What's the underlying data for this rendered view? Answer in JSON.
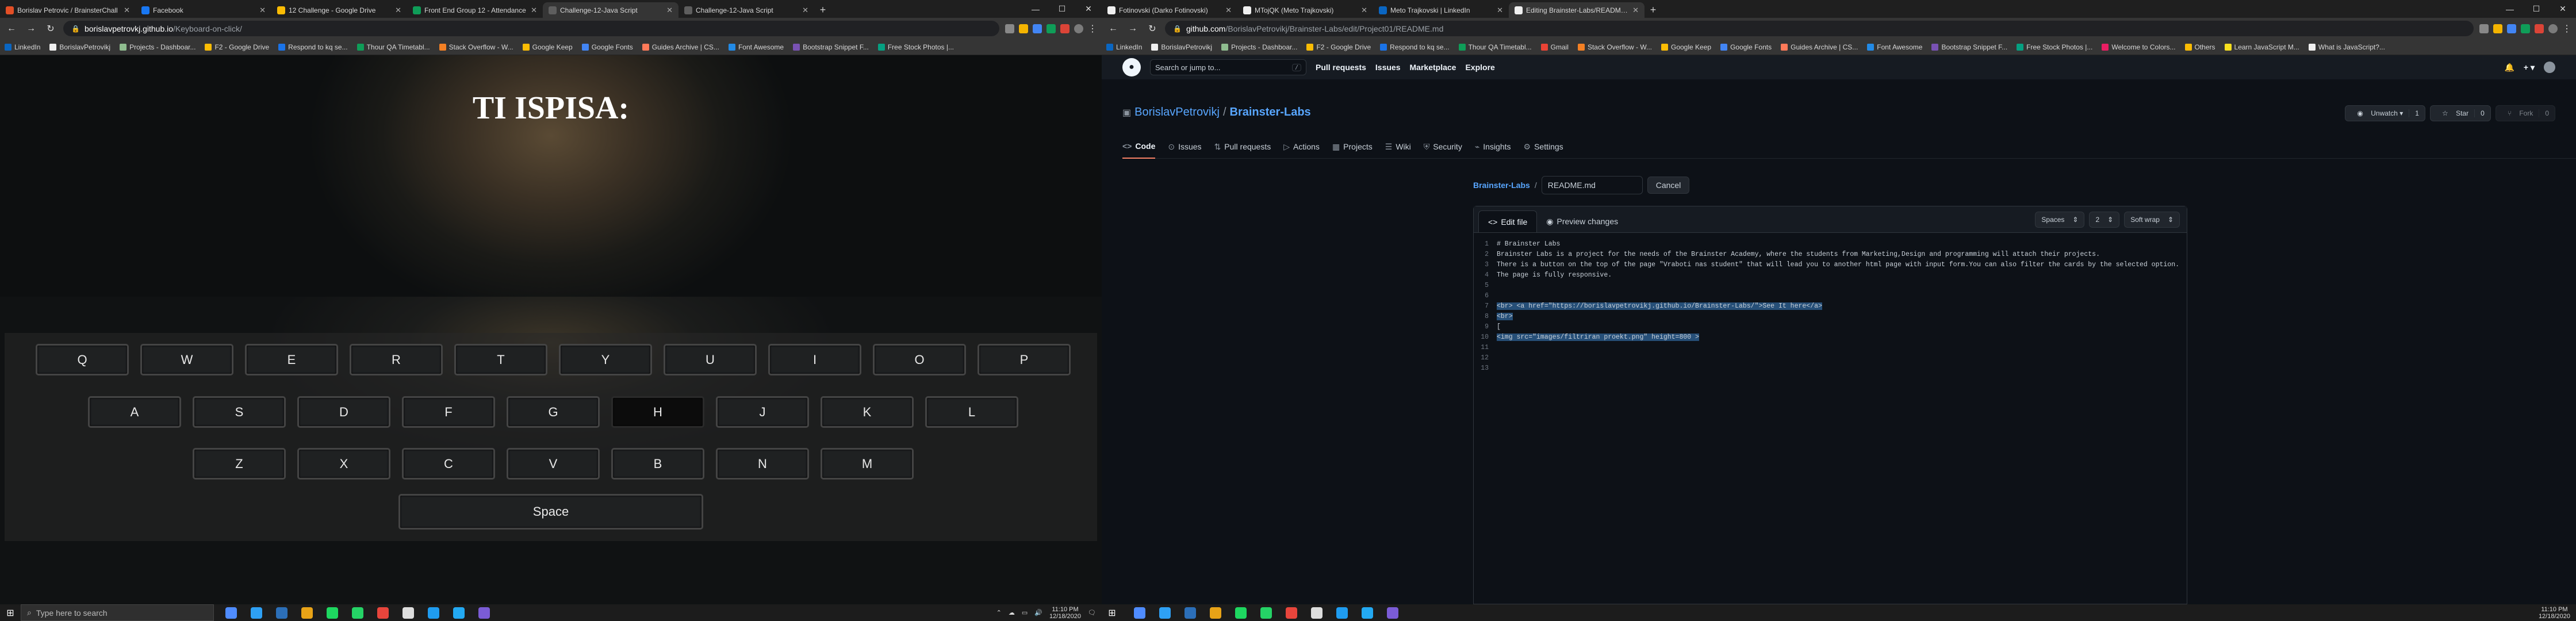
{
  "left_browser": {
    "tabs": [
      {
        "title": "Borislav Petrovic / BrainsterChall",
        "fav": "#e34f26",
        "active": false
      },
      {
        "title": "Facebook",
        "fav": "#1877f2",
        "active": false
      },
      {
        "title": "12 Challenge - Google Drive",
        "fav": "#fbbc04",
        "active": false
      },
      {
        "title": "Front End Group 12 - Attendance",
        "fav": "#0f9d58",
        "active": false
      },
      {
        "title": "Challenge-12-Java Script",
        "fav": "#5e5e5e",
        "active": true
      },
      {
        "title": "Challenge-12-Java Script",
        "fav": "#5e5e5e",
        "active": false
      }
    ],
    "address": {
      "host": "borislavpetrovkj.github.io",
      "path": "/Keyboard-on-click/"
    },
    "bookmarks": [
      {
        "label": "LinkedIn",
        "color": "#0a66c2"
      },
      {
        "label": "BorislavPetrovikj",
        "color": "#f0f0f0"
      },
      {
        "label": "Projects - Dashboar...",
        "color": "#8fbc8f"
      },
      {
        "label": "F2 - Google Drive",
        "color": "#fbbc04"
      },
      {
        "label": "Respond to kq se...",
        "color": "#1a73e8"
      },
      {
        "label": "Thour QA Timetabl...",
        "color": "#0f9d58"
      },
      {
        "label": "Stack Overflow - W...",
        "color": "#f48024"
      },
      {
        "label": "Google Keep",
        "color": "#fbbc04"
      },
      {
        "label": "Google Fonts",
        "color": "#4285f4"
      },
      {
        "label": "Guides Archive | CS...",
        "color": "#ff7a59"
      },
      {
        "label": "Font Awesome",
        "color": "#228ae6"
      },
      {
        "label": "Bootstrap Snippet F...",
        "color": "#7952b3"
      },
      {
        "label": "Free Stock Photos |...",
        "color": "#05a081"
      }
    ]
  },
  "keyboard_page": {
    "heading": "TI ISPISA:",
    "rows": [
      [
        "Q",
        "W",
        "E",
        "R",
        "T",
        "Y",
        "U",
        "I",
        "O",
        "P"
      ],
      [
        "A",
        "S",
        "D",
        "F",
        "G",
        "H",
        "J",
        "K",
        "L"
      ],
      [
        "Z",
        "X",
        "C",
        "V",
        "B",
        "N",
        "M"
      ]
    ],
    "active_key": "H",
    "space_label": "Space"
  },
  "right_browser": {
    "tabs": [
      {
        "title": "Fotinovski (Darko Fotinovski)",
        "fav": "#f0f0f0",
        "active": false
      },
      {
        "title": "MTojQK (Meto Trajkovski)",
        "fav": "#f0f0f0",
        "active": false
      },
      {
        "title": "Meto Trajkovski | LinkedIn",
        "fav": "#0a66c2",
        "active": false
      },
      {
        "title": "Editing Brainster-Labs/README.m",
        "fav": "#f0f0f0",
        "active": true
      }
    ],
    "address": {
      "host": "github.com",
      "path": "/BorislavPetrovikj/Brainster-Labs/edit/Project01/README.md"
    },
    "bookmarks": [
      {
        "label": "LinkedIn",
        "color": "#0a66c2"
      },
      {
        "label": "BorislavPetrovikj",
        "color": "#f0f0f0"
      },
      {
        "label": "Projects - Dashboar...",
        "color": "#8fbc8f"
      },
      {
        "label": "F2 - Google Drive",
        "color": "#fbbc04"
      },
      {
        "label": "Respond to kq se...",
        "color": "#1a73e8"
      },
      {
        "label": "Thour QA Timetabl...",
        "color": "#0f9d58"
      },
      {
        "label": "Gmail",
        "color": "#ea4335"
      },
      {
        "label": "Stack Overflow - W...",
        "color": "#f48024"
      },
      {
        "label": "Google Keep",
        "color": "#fbbc04"
      },
      {
        "label": "Google Fonts",
        "color": "#4285f4"
      },
      {
        "label": "Guides Archive | CS...",
        "color": "#ff7a59"
      },
      {
        "label": "Font Awesome",
        "color": "#228ae6"
      },
      {
        "label": "Bootstrap Snippet F...",
        "color": "#7952b3"
      },
      {
        "label": "Free Stock Photos |...",
        "color": "#05a081"
      },
      {
        "label": "Welcome to Colors...",
        "color": "#e91e63"
      },
      {
        "label": "Others",
        "color": "#fbbc04"
      },
      {
        "label": "Learn JavaScript M...",
        "color": "#f7df1e"
      },
      {
        "label": "What is JavaScript?...",
        "color": "#f0f0f0"
      }
    ]
  },
  "github": {
    "search_placeholder": "Search or jump to...",
    "search_kbd": "/",
    "nav": [
      "Pull requests",
      "Issues",
      "Marketplace",
      "Explore"
    ],
    "owner": "BorislavPetrovikj",
    "repo": "Brainster-Labs",
    "unwatch": {
      "label": "Unwatch",
      "count": "1"
    },
    "star": {
      "label": "Star",
      "count": "0"
    },
    "fork": {
      "label": "Fork",
      "count": "0"
    },
    "tabs": [
      "Code",
      "Issues",
      "Pull requests",
      "Actions",
      "Projects",
      "Wiki",
      "Security",
      "Insights",
      "Settings"
    ],
    "breadcrumb_repo": "Brainster-Labs",
    "breadcrumb_sep": "/",
    "filename": "README.md",
    "cancel_label": "Cancel",
    "edit_tab": "Edit file",
    "preview_tab": "Preview changes",
    "indent_mode": "Spaces",
    "indent_size": "2",
    "wrap_mode": "Soft wrap",
    "lines": [
      {
        "n": "1",
        "text": "# Brainster Labs",
        "hl": false
      },
      {
        "n": "2",
        "text": "Brainster Labs is a project for the needs of the Brainster Academy, where the students from Marketing,Design and programming will attach their projects.",
        "hl": false
      },
      {
        "n": "3",
        "text": "There is a button on the top of the page \"Vraboti nas student\" that will lead you to another html page with input form.You can also filter the cards by the selected option.",
        "hl": false
      },
      {
        "n": "4",
        "text": "The page is fully responsive.",
        "hl": false
      },
      {
        "n": "5",
        "text": "",
        "hl": false
      },
      {
        "n": "6",
        "text": "",
        "hl": false
      },
      {
        "n": "7",
        "text": "<br> <a href=\"https://borislavpetrovikj.github.io/Brainster-Labs/\">See It here</a>",
        "hl": true
      },
      {
        "n": "8",
        "text": "<br>",
        "hl": true
      },
      {
        "n": "9",
        "text": "[",
        "hl": false
      },
      {
        "n": "10",
        "text": "<img src=\"images/filtriran proekt.png\" height=800 >",
        "hl": true
      },
      {
        "n": "11",
        "text": "",
        "hl": false
      },
      {
        "n": "12",
        "text": "",
        "hl": false
      },
      {
        "n": "13",
        "text": "",
        "hl": false
      }
    ]
  },
  "taskbar_left": {
    "search_placeholder": "Type here to search",
    "time": "11:10 PM",
    "date": "12/18/2020",
    "apps": [
      "#4f8cff",
      "#2ea0f4",
      "#2c6fb8",
      "#e8a317",
      "#1ed760",
      "#25d366",
      "#e7453c",
      "#dddddd",
      "#1f9cf0",
      "#23a9f2",
      "#7b5cd6"
    ]
  },
  "taskbar_right": {
    "time": "11:10 PM",
    "date": "12/18/2020",
    "apps": [
      "#4f8cff",
      "#2ea0f4",
      "#2c6fb8",
      "#e8a317",
      "#1ed760",
      "#25d366",
      "#e7453c",
      "#dddddd",
      "#1f9cf0",
      "#23a9f2",
      "#7b5cd6"
    ]
  }
}
